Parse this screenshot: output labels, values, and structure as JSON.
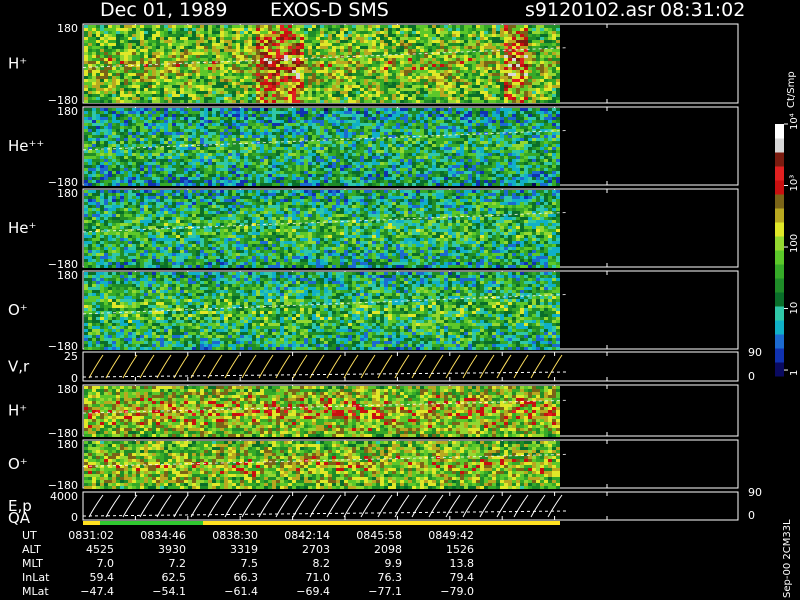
{
  "header": {
    "date": "Dec 01, 1989",
    "instrument": "EXOS-D SMS",
    "file": "s9120102.asr",
    "time": "08:31:02"
  },
  "colorbar": {
    "unit": "Ct/Smp",
    "ticks": [
      {
        "value": 1,
        "label": "1"
      },
      {
        "value": 10,
        "label": "10"
      },
      {
        "value": 100,
        "label": "100"
      },
      {
        "value": 1000,
        "label": "10³"
      },
      {
        "value": 10000,
        "label": "10⁴"
      }
    ],
    "scale": "log",
    "range": [
      0.8,
      10000
    ],
    "colors": [
      "#0a0a60",
      "#1032b0",
      "#1c6ad0",
      "#10b0c8",
      "#30c8a8",
      "#0a6e2a",
      "#1f8c28",
      "#36aa28",
      "#5cc82a",
      "#94d830",
      "#e0e828",
      "#b8a820",
      "#7a6418",
      "#c81010",
      "#e02020",
      "#7a1c10",
      "#d8d8d8",
      "#ffffff"
    ]
  },
  "side_label": "Sep-00  2CM33L",
  "chart_data": [
    {
      "type": "heatmap",
      "name": "H⁺",
      "ylabel": "H⁺",
      "ylim": [
        -180,
        180
      ],
      "yticks": [
        "180",
        "−180"
      ],
      "cmap_base": 0.55,
      "bright_bands": [
        0.38,
        0.43,
        0.9
      ]
    },
    {
      "type": "heatmap",
      "name": "He⁺⁺",
      "ylabel": "He⁺⁺",
      "ylim": [
        -180,
        180
      ],
      "yticks": [
        "180",
        "−180"
      ],
      "cmap_base": 0.35
    },
    {
      "type": "heatmap",
      "name": "He⁺",
      "ylabel": "He⁺",
      "ylim": [
        -180,
        180
      ],
      "yticks": [
        "180",
        "−180"
      ],
      "cmap_base": 0.38
    },
    {
      "type": "heatmap",
      "name": "O⁺",
      "ylabel": "O⁺",
      "ylim": [
        -180,
        180
      ],
      "yticks": [
        "180",
        "−180"
      ],
      "cmap_base": 0.4
    },
    {
      "type": "line",
      "name": "V,r",
      "ylabel": "V,r",
      "ylim": [
        0,
        25
      ],
      "yticks": [
        "25",
        "0"
      ],
      "right_ticks": [
        "90",
        "0"
      ]
    },
    {
      "type": "heatmap",
      "name": "H⁺ (2)",
      "ylabel": "H⁺",
      "ylim": [
        -180,
        180
      ],
      "yticks": [
        "180",
        "−180"
      ],
      "cmap_base": 0.62
    },
    {
      "type": "heatmap",
      "name": "O⁺ (2)",
      "ylabel": "O⁺",
      "ylim": [
        -180,
        180
      ],
      "yticks": [
        "180",
        "−180"
      ],
      "cmap_base": 0.58
    },
    {
      "type": "line",
      "name": "E,p",
      "ylabel": "E,p",
      "ylim": [
        0,
        4000
      ],
      "yticks": [
        "4000",
        "0"
      ],
      "right_ticks": [
        "90",
        "0"
      ]
    }
  ],
  "qa_label": "QA",
  "ephemeris": {
    "rows": [
      {
        "name": "UT",
        "values": [
          "0831:02",
          "0834:46",
          "0838:30",
          "0842:14",
          "0845:58",
          "0849:42"
        ]
      },
      {
        "name": "ALT",
        "values": [
          "4525",
          "3930",
          "3319",
          "2703",
          "2098",
          "1526"
        ]
      },
      {
        "name": "MLT",
        "values": [
          "7.0",
          "7.2",
          "7.5",
          "8.2",
          "9.9",
          "13.8"
        ]
      },
      {
        "name": "InLat",
        "values": [
          "59.4",
          "62.5",
          "66.3",
          "71.0",
          "76.3",
          "79.4"
        ]
      },
      {
        "name": "MLat",
        "values": [
          "−47.4",
          "−54.1",
          "−61.4",
          "−69.4",
          "−77.1",
          "−79.0"
        ]
      }
    ]
  }
}
